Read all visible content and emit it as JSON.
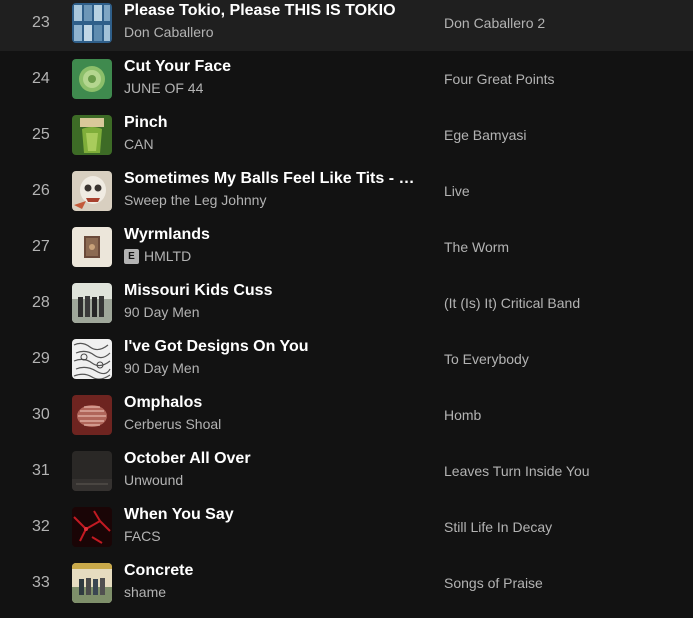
{
  "tracks": [
    {
      "num": "23",
      "title": "Please Tokio, Please THIS IS TOKIO",
      "artist": "Don Caballero",
      "album": "Don Caballero 2",
      "explicit": false,
      "art_icon": "album-art-don-caballero-2",
      "art_color": "#2f5f8a"
    },
    {
      "num": "24",
      "title": "Cut Your Face",
      "artist": "JUNE OF 44",
      "album": "Four Great Points",
      "explicit": false,
      "art_icon": "album-art-four-great-points",
      "art_color": "#3f8a4e"
    },
    {
      "num": "25",
      "title": "Pinch",
      "artist": "CAN",
      "album": "Ege Bamyasi",
      "explicit": false,
      "art_icon": "album-art-ege-bamyasi",
      "art_color": "#4a7a2c"
    },
    {
      "num": "26",
      "title": "Sometimes My Balls Feel Like Tits - Part…",
      "artist": "Sweep the Leg Johnny",
      "album": "Live",
      "explicit": false,
      "art_icon": "album-art-live",
      "art_color": "#d8cfc0"
    },
    {
      "num": "27",
      "title": "Wyrmlands",
      "artist": "HMLTD",
      "album": "The Worm",
      "explicit": true,
      "explicit_label": "E",
      "art_icon": "album-art-the-worm",
      "art_color": "#ece6da"
    },
    {
      "num": "28",
      "title": "Missouri Kids Cuss",
      "artist": "90 Day Men",
      "album": "(It (Is) It) Critical Band",
      "explicit": false,
      "art_icon": "album-art-critical-band",
      "art_color": "#c9cfc6"
    },
    {
      "num": "29",
      "title": "I've Got Designs On You",
      "artist": "90 Day Men",
      "album": "To Everybody",
      "explicit": false,
      "art_icon": "album-art-to-everybody",
      "art_color": "#e0e0e0"
    },
    {
      "num": "30",
      "title": "Omphalos",
      "artist": "Cerberus Shoal",
      "album": "Homb",
      "explicit": false,
      "art_icon": "album-art-homb",
      "art_color": "#7a2a25"
    },
    {
      "num": "31",
      "title": "October All Over",
      "artist": "Unwound",
      "album": "Leaves Turn Inside You",
      "explicit": false,
      "art_icon": "album-art-leaves-turn-inside-you",
      "art_color": "#2a2826"
    },
    {
      "num": "32",
      "title": "When You Say",
      "artist": "FACS",
      "album": "Still Life In Decay",
      "explicit": false,
      "art_icon": "album-art-still-life-in-decay",
      "art_color": "#3a0a0c"
    },
    {
      "num": "33",
      "title": "Concrete",
      "artist": "shame",
      "album": "Songs of Praise",
      "explicit": false,
      "art_icon": "album-art-songs-of-praise",
      "art_color": "#d9d1b8"
    }
  ]
}
